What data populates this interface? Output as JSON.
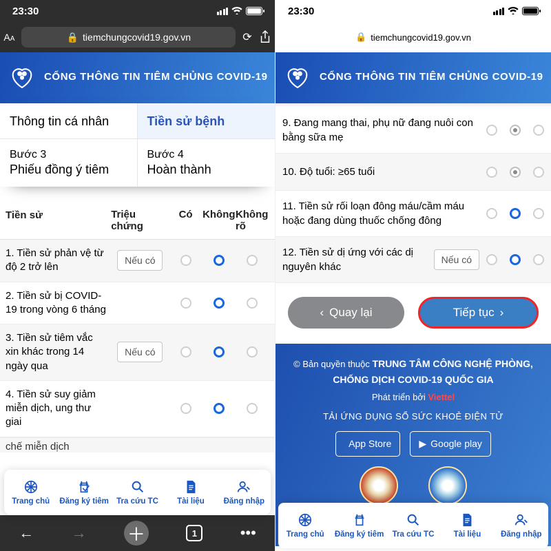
{
  "status_time": "23:30",
  "url": "tiemchungcovid19.gov.vn",
  "site_title": "CỔNG THÔNG TIN TIÊM CHỦNG COVID-19",
  "wizard": {
    "step1": "Thông tin cá nhân",
    "step2": "Tiền sử bệnh",
    "step3_label": "Bước 3",
    "step3": "Phiếu đồng ý tiêm",
    "step4_label": "Bước 4",
    "step4": "Hoàn thành"
  },
  "table_head": {
    "c1": "Tiền sử",
    "c2": "Triệu chứng",
    "c3": "Có",
    "c4": "Không",
    "c5": "Không rõ"
  },
  "neu_co": "Nếu có",
  "left_rows": {
    "r1": "1. Tiền sử phản vệ từ độ 2 trở lên",
    "r2": "2. Tiền sử bị COVID-19 trong vòng 6 tháng",
    "r3": "3. Tiền sử tiêm vắc xin khác trong 14 ngày qua",
    "r4": "4. Tiền sử suy giảm miễn dịch, ung thư giai",
    "cut": "chế miễn dịch"
  },
  "right_rows": {
    "r9": "9. Đang mang thai, phụ nữ đang nuôi con bằng sữa mẹ",
    "r10": "10. Độ tuổi: ≥65 tuổi",
    "r11": "11. Tiền sử rối loạn đông máu/cầm máu hoặc đang dùng thuốc chống đông",
    "r12": "12. Tiền sử dị ứng với các dị nguyên khác"
  },
  "buttons": {
    "back": "Quay lại",
    "next": "Tiếp tục"
  },
  "footer": {
    "line1a": "© Bản quyền thuộc",
    "line1b": "TRUNG TÂM CÔNG NGHỆ PHÒNG, CHỐNG DỊCH COVID-19 QUỐC GIA",
    "dev": "Phát triển bởi",
    "dev_by": "Viettel",
    "subtitle": "TẢI ỨNG DỤNG SỔ SỨC KHOẺ ĐIỆN TỬ",
    "appstore": "App Store",
    "gplay": "Google play"
  },
  "nav": {
    "home": "Trang chủ",
    "reg": "Đăng ký tiêm",
    "lookup": "Tra cứu TC",
    "docs": "Tài liệu",
    "login": "Đăng nhập"
  },
  "safari_tabs": "1"
}
